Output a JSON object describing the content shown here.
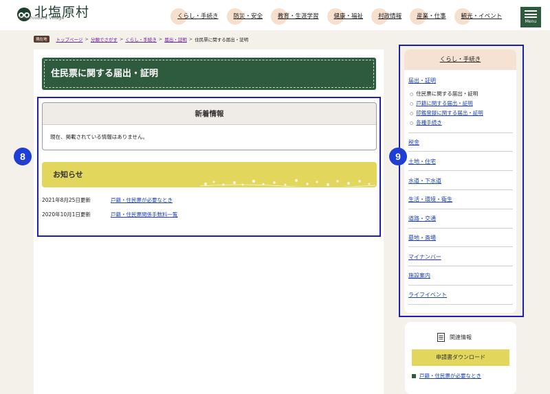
{
  "header": {
    "logo_title": "北塩原村",
    "logo_sub": "Kitashiobara Village",
    "nav": [
      "くらし・手続き",
      "防災・安全",
      "教育・生涯学習",
      "健康・福祉",
      "村政情報",
      "産業・仕事",
      "観光・イベント"
    ],
    "menu_label": "Menu"
  },
  "breadcrumb": {
    "badge": "現在地",
    "items": [
      "トップページ",
      "分類でさがす",
      "くらし・手続き",
      "届出・証明"
    ],
    "current": "住民票に関する届出・証明",
    "sep": ">"
  },
  "page_title": "住民票に関する届出・証明",
  "badges": {
    "main": "8",
    "side": "9"
  },
  "news": {
    "heading": "新着情報",
    "empty_message": "現在、掲載されている情報はありません。"
  },
  "notice": {
    "heading": "お知らせ",
    "items": [
      {
        "date": "2021年8月25日更新",
        "title": "戸籍・住民票が必要なとき"
      },
      {
        "date": "2020年10月1日更新",
        "title": "戸籍・住民票関係手数料一覧"
      }
    ]
  },
  "sidebar": {
    "heading": "くらし・手続き",
    "first_category": "届出・証明",
    "sub_items": [
      "住民票に関する届出・証明",
      "戸籍に関する届出・証明",
      "印鑑登録に関する届出・証明",
      "各種手続き"
    ],
    "categories": [
      "税金",
      "土地・住宅",
      "水道・下水道",
      "生活・環境・衛生",
      "道路・交通",
      "墓地・斎場",
      "マイナンバー",
      "施設案内",
      "ライフイベント"
    ]
  },
  "related": {
    "heading": "関連情報",
    "download_label": "申請書ダウンロード",
    "link": "戸籍・住民票が必要なとき"
  },
  "colors": {
    "brand_green": "#2e5a3e",
    "accent_yellow": "#e2d65c",
    "nav_peach": "#f7dfcd",
    "focus_blue": "#1c1cb8",
    "badge_blue": "#1f3fd4"
  }
}
